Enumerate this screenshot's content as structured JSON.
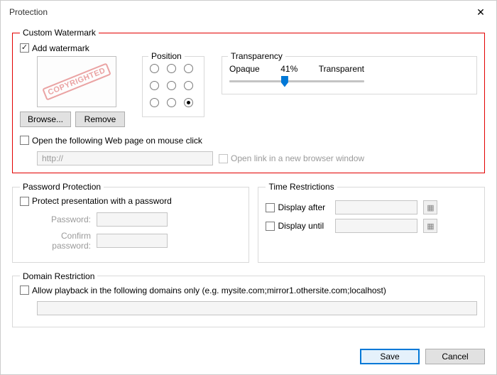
{
  "dialog": {
    "title": "Protection"
  },
  "watermark": {
    "legend": "Custom Watermark",
    "add_label": "Add watermark",
    "add_checked": true,
    "preview_stamp": "COPYRIGHTED",
    "browse_label": "Browse...",
    "remove_label": "Remove",
    "position": {
      "legend": "Position",
      "selected_index": 8
    },
    "transparency": {
      "legend": "Transparency",
      "opaque_label": "Opaque",
      "value_label": "41%",
      "transparent_label": "Transparent",
      "percent": 41
    },
    "open_link_label": "Open the following Web page on mouse click",
    "open_link_checked": false,
    "url_value": "http://",
    "new_window_label": "Open link in a new browser window",
    "new_window_checked": false
  },
  "password": {
    "legend": "Password Protection",
    "protect_label": "Protect presentation with a password",
    "protect_checked": false,
    "password_label": "Password:",
    "confirm_label": "Confirm password:"
  },
  "time": {
    "legend": "Time Restrictions",
    "after_label": "Display after",
    "after_checked": false,
    "until_label": "Display until",
    "until_checked": false
  },
  "domain": {
    "legend": "Domain Restriction",
    "allow_label": "Allow playback in the following domains only (e.g. mysite.com;mirror1.othersite.com;localhost)",
    "allow_checked": false
  },
  "footer": {
    "save_label": "Save",
    "cancel_label": "Cancel"
  }
}
